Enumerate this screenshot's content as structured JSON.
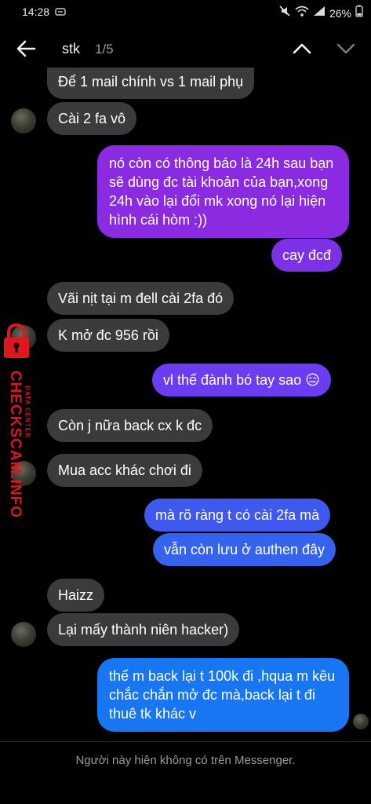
{
  "status_bar": {
    "time": "14:28",
    "battery": "26%"
  },
  "header": {
    "search_term": "stk",
    "match_counter": "1/5"
  },
  "messages": [
    {
      "text": "Để 1 mail chính vs 1 mail phụ"
    },
    {
      "text": "Cài 2 fa vô"
    },
    {
      "text": "nó còn có thông báo là 24h sau bạn sẽ dùng đc tài khoản của bạn,xong 24h vào lại đổi mk xong nó lại hiện hình cái hòm :))"
    },
    {
      "text": "cay đcđ"
    },
    {
      "text": "Vãi nịt tại m đell cài 2fa đó"
    },
    {
      "text": "K mở đc 956 rồi"
    },
    {
      "text": "vl thế đành bó tay sao 😑"
    },
    {
      "text": "Còn j nữa back cx k đc"
    },
    {
      "text": "Mua acc khác chơi đi"
    },
    {
      "text": "mà rõ ràng t có cài 2fa mà"
    },
    {
      "text": "vẫn còn lưu ở authen đây"
    },
    {
      "text": "Haizz"
    },
    {
      "text": "Lại mấy thành niên hacker)"
    },
    {
      "text": "thế m back lại t 100k đi ,hqua m kêu chắc chắn mở đc mà,back lại t đi thuê tk khác v"
    }
  ],
  "footer": {
    "notice": "Người này hiện không có trên Messenger."
  },
  "watermark": {
    "site": "CHECKSCAM.INFO",
    "tagline": "DATA CENTER"
  },
  "colors": {
    "received": "#3a3b3c",
    "sent_top": "#8a2be2",
    "sent_mid": "#6a3df0",
    "sent_bottom": "#1976f2"
  }
}
